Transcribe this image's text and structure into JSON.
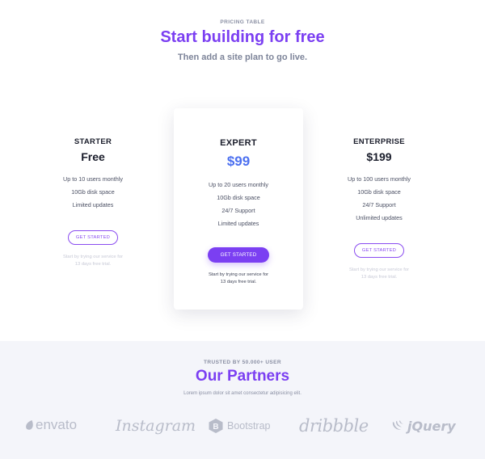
{
  "header": {
    "eyebrow": "PRICING TABLE",
    "title": "Start building for free",
    "subtitle": "Then add a site plan to go live."
  },
  "plans": [
    {
      "name": "STARTER",
      "price": "Free",
      "features": [
        "Up to 10 users monthly",
        "10Gb disk space",
        "Limited updates"
      ],
      "button": "GET STARTED",
      "trial_line1": "Start by trying our service for",
      "trial_line2": "13 days free trial."
    },
    {
      "name": "EXPERT",
      "price": "$99",
      "features": [
        "Up to 20 users monthly",
        "10Gb disk space",
        "24/7 Support",
        "Limited updates"
      ],
      "button": "GET STARTED",
      "trial_line1": "Start by trying our service for",
      "trial_line2": "13 days free trial."
    },
    {
      "name": "ENTERPRISE",
      "price": "$199",
      "features": [
        "Up to 100 users monthly",
        "10Gb disk space",
        "24/7 Support",
        "Unlimited updates"
      ],
      "button": "GET STARTED",
      "trial_line1": "Start by trying our service for",
      "trial_line2": "13 days free trial."
    }
  ],
  "partners": {
    "eyebrow": "TRUSTED BY 50.000+ USER",
    "title": "Our Partners",
    "subtitle": "Lorem ipsum dolor sit amet consectetur adipisicing elit.",
    "logos": [
      "envato",
      "Instagram",
      "Bootstrap",
      "dribbble",
      "jQuery"
    ]
  },
  "colors": {
    "accent": "#7b3ff2",
    "price_highlight": "#4b6ff0",
    "muted": "#7d8499",
    "partners_bg": "#f4f5fa",
    "logo_gray": "#b8bcc9"
  }
}
